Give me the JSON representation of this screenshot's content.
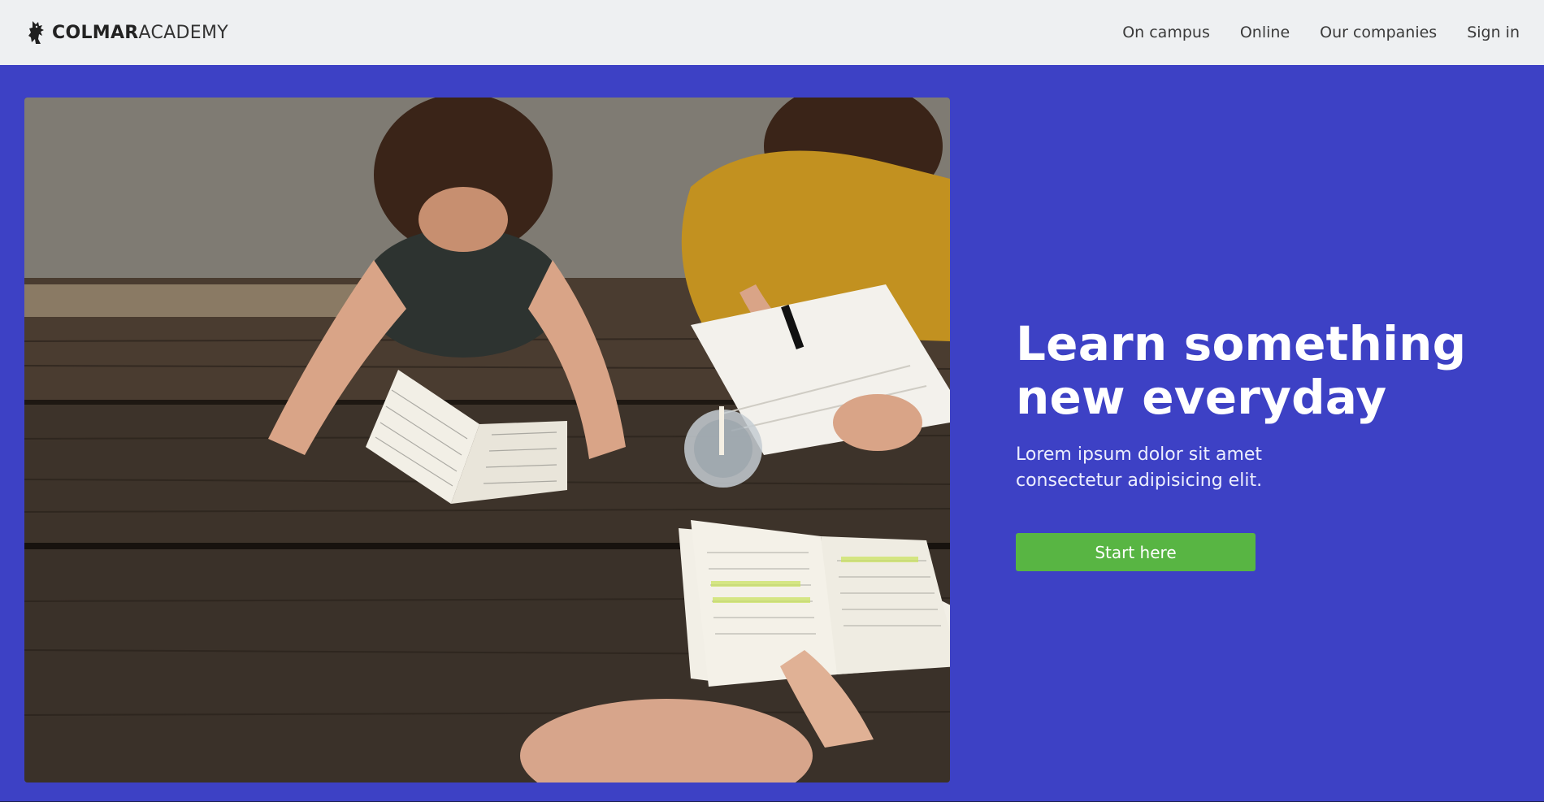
{
  "brand": {
    "name_bold": "COLMAR",
    "name_light": "ACADEMY",
    "logo_icon": "griffin-icon"
  },
  "nav": {
    "items": [
      {
        "label": "On campus"
      },
      {
        "label": "Online"
      },
      {
        "label": "Our companies"
      },
      {
        "label": "Sign in"
      }
    ]
  },
  "hero": {
    "headline_line1": "Learn something",
    "headline_line2": "new everyday",
    "subline_line1": "Lorem ipsum dolor sit amet",
    "subline_line2": "consectetur adipisicing elit.",
    "cta_label": "Start here"
  },
  "colors": {
    "header_bg": "#eef0f2",
    "hero_bg": "#3d41c5",
    "cta_bg": "#58b543",
    "text_light": "#ffffff"
  }
}
